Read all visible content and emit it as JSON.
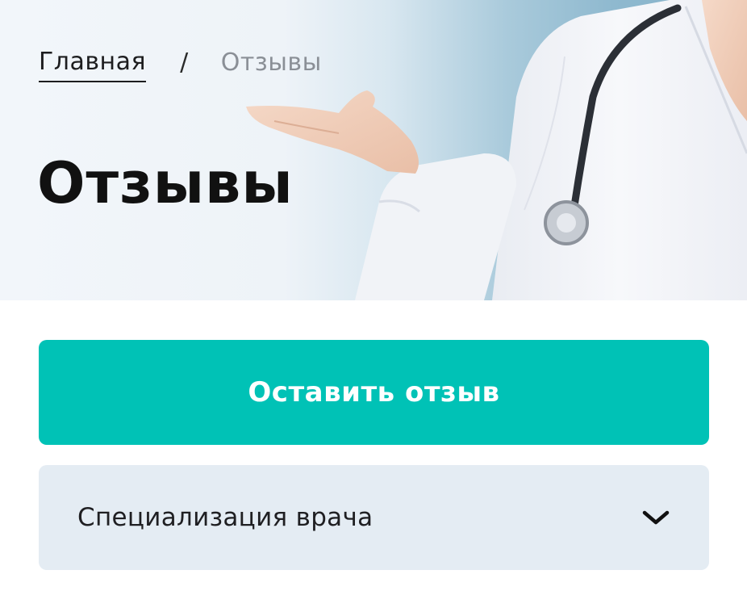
{
  "breadcrumb": {
    "home": "Главная",
    "separator": "/",
    "current": "Отзывы"
  },
  "page": {
    "title": "Отзывы"
  },
  "actions": {
    "leave_review": "Оставить отзыв"
  },
  "filter": {
    "specialization": {
      "selected": "Специализация врача",
      "icon": "chevron-down-icon"
    }
  },
  "colors": {
    "accent": "#00c2b6",
    "select_bg": "#e4ecf3",
    "title": "#111111",
    "breadcrumb_current": "#8a8f96"
  }
}
